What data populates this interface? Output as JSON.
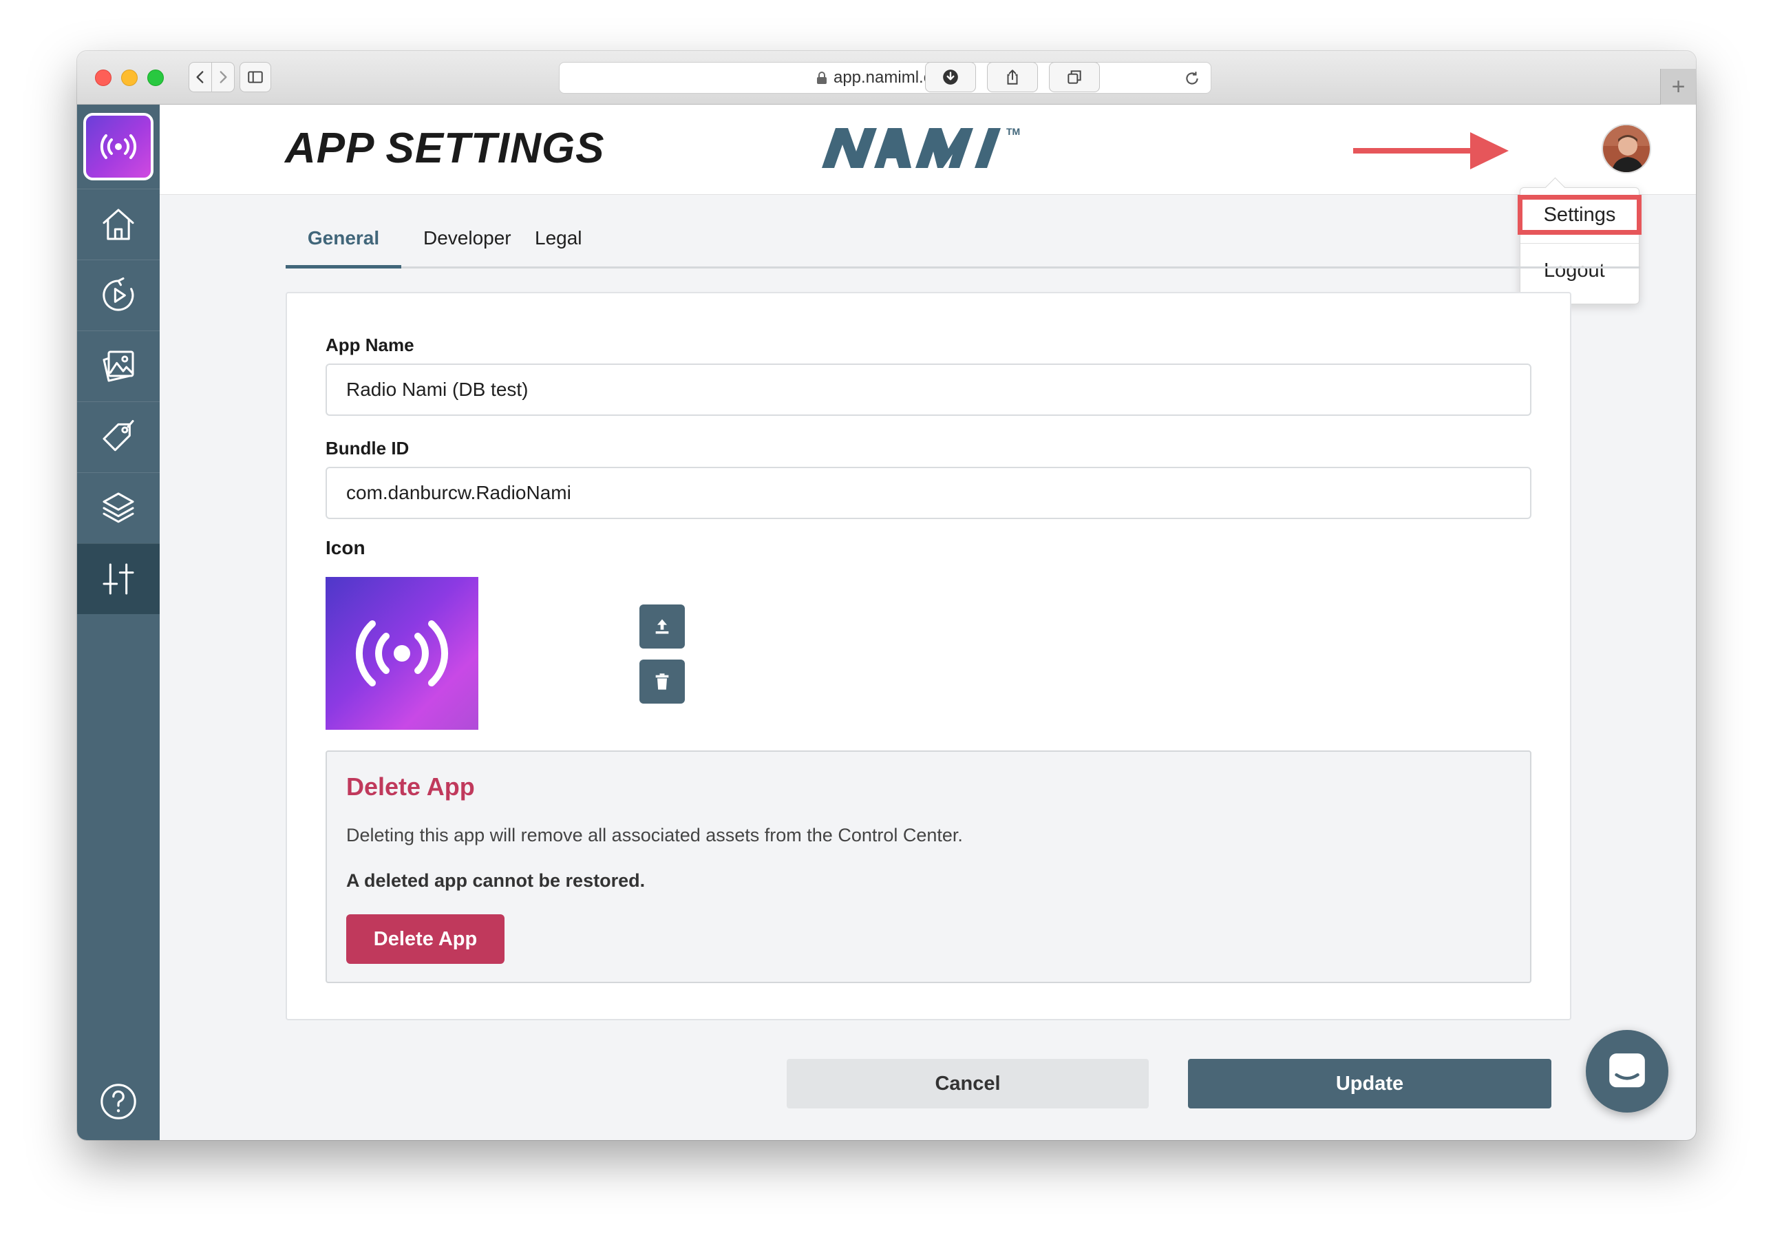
{
  "browser": {
    "url": "app.namiml.com"
  },
  "header": {
    "title": "APP SETTINGS",
    "brand": "NAMI",
    "brand_tm": "TM"
  },
  "user_menu": {
    "items": [
      {
        "label": "Settings"
      },
      {
        "label": "Logout"
      }
    ]
  },
  "sidebar": {
    "items": [
      {
        "icon": "home-icon"
      },
      {
        "icon": "play-circle-icon"
      },
      {
        "icon": "gallery-icon"
      },
      {
        "icon": "tag-icon"
      },
      {
        "icon": "layers-icon"
      },
      {
        "icon": "sliders-icon",
        "active": true
      }
    ],
    "help_icon": "help-icon"
  },
  "tabs": [
    {
      "label": "General",
      "active": true
    },
    {
      "label": "Developer"
    },
    {
      "label": "Legal"
    }
  ],
  "form": {
    "app_name_label": "App Name",
    "app_name_value": "Radio Nami (DB test)",
    "bundle_id_label": "Bundle ID",
    "bundle_id_value": "com.danburcw.RadioNami",
    "icon_label": "Icon"
  },
  "danger_zone": {
    "title": "Delete App",
    "description": "Deleting this app will remove all associated assets from the Control Center.",
    "warning": "A deleted app cannot be restored.",
    "button_label": "Delete App"
  },
  "footer": {
    "cancel_label": "Cancel",
    "update_label": "Update"
  },
  "colors": {
    "sidebar": "#4a6676",
    "accent": "#41667a",
    "danger": "#c0395c",
    "annotation": "#e6565a"
  }
}
